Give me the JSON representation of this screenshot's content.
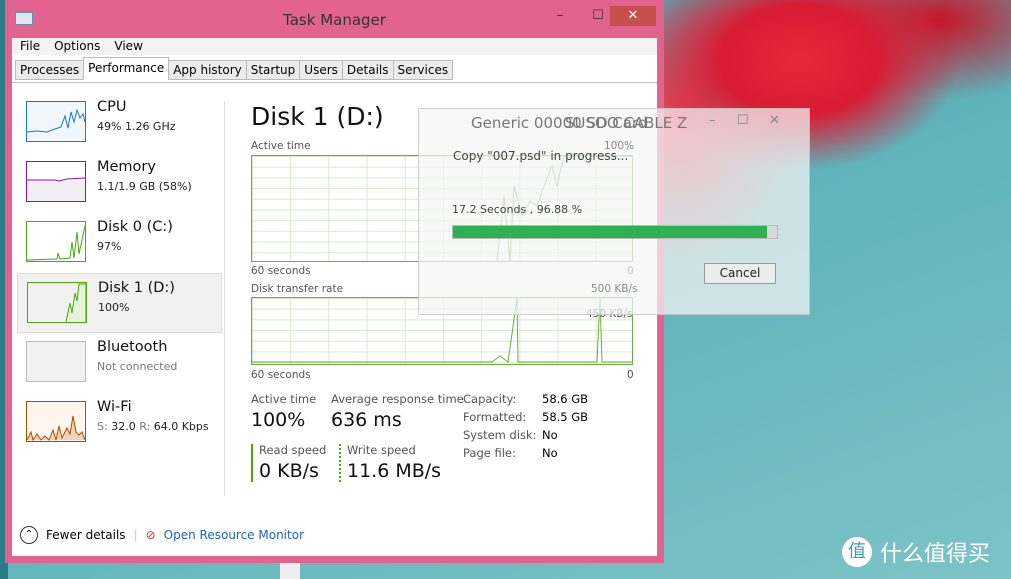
{
  "window": {
    "title": "Task Manager",
    "minimize": "–",
    "maximize": "☐",
    "close": "✕"
  },
  "menu": [
    "File",
    "Options",
    "View"
  ],
  "tabs": [
    "Processes",
    "Performance",
    "App history",
    "Startup",
    "Users",
    "Details",
    "Services"
  ],
  "sidebar": [
    {
      "name": "CPU",
      "sub": "49% 1.26 GHz",
      "color": "#1979ca"
    },
    {
      "name": "Memory",
      "sub": "1.1/1.9 GB (58%)",
      "color": "#8b12ae"
    },
    {
      "name": "Disk 0 (C:)",
      "sub": "97%",
      "color": "#4da60c"
    },
    {
      "name": "Disk 1 (D:)",
      "sub": "100%",
      "color": "#4da60c"
    },
    {
      "name": "Bluetooth",
      "sub": "Not connected",
      "color": "#bbbbbb"
    },
    {
      "name": "Wi-Fi",
      "sub_s": "S:",
      "sub_s_val": "32.0",
      "sub_r": "R:",
      "sub_r_val": "64.0 Kbps",
      "color": "#a74f01"
    }
  ],
  "main": {
    "title": "Disk 1 (D:)",
    "active_graph": {
      "label": "Active time",
      "max": "100%",
      "min": "0",
      "time": "60 seconds"
    },
    "transfer_graph": {
      "label": "Disk transfer rate",
      "max": "500 KB/s",
      "mid": "450 KB/s",
      "min": "0",
      "time": "60 seconds"
    },
    "active_time_label": "Active time",
    "active_time": "100%",
    "avg_resp_label": "Average response time",
    "avg_resp": "636 ms",
    "read_label": "Read speed",
    "read": "0 KB/s",
    "write_label": "Write speed",
    "write": "11.6 MB/s",
    "props": [
      [
        "Capacity:",
        "58.6 GB"
      ],
      [
        "Formatted:",
        "58.5 GB"
      ],
      [
        "System disk:",
        "No"
      ],
      [
        "Page file:",
        "No"
      ]
    ]
  },
  "footer": {
    "fewer": "Fewer details",
    "monitor": "Open Resource Monitor"
  },
  "dialog": {
    "title": "Generic 00000 SD Card",
    "title_overlap": "SUSOO CABLE Z",
    "message": "Copy \"007.psd\" in progress...",
    "progress_text": "17.2 Seconds , 96.88 %",
    "progress": 96.88,
    "cancel": "Cancel",
    "accent": "#2fb052"
  },
  "brand": {
    "icon": "值",
    "text": "什么值得买"
  }
}
